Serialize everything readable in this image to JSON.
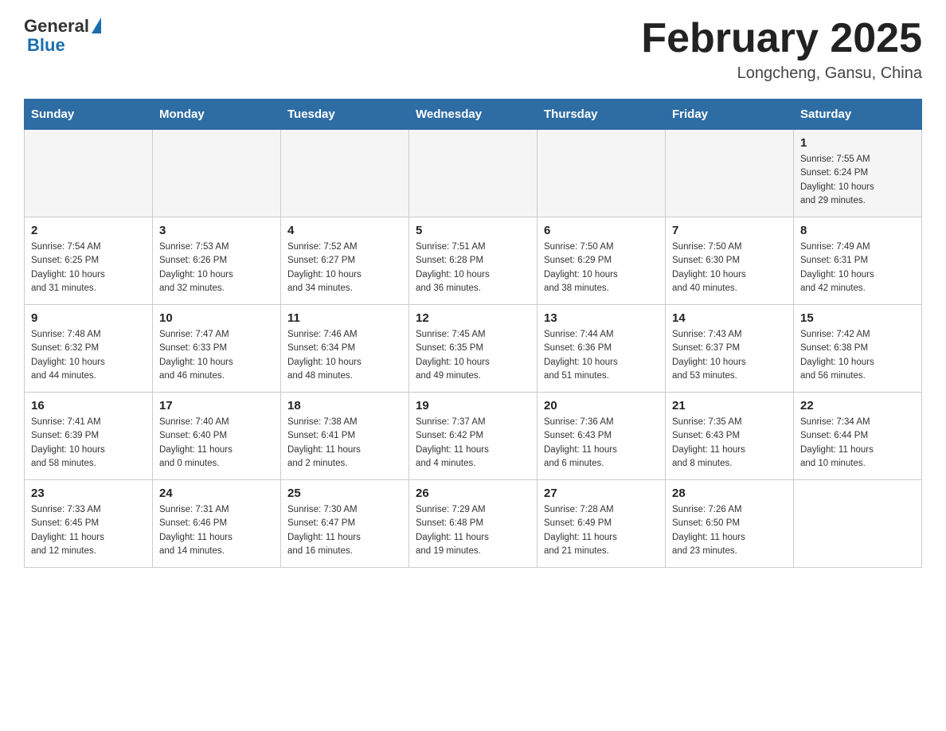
{
  "header": {
    "logo_general": "General",
    "logo_blue": "Blue",
    "month_title": "February 2025",
    "location": "Longcheng, Gansu, China"
  },
  "weekdays": [
    "Sunday",
    "Monday",
    "Tuesday",
    "Wednesday",
    "Thursday",
    "Friday",
    "Saturday"
  ],
  "weeks": [
    [
      {
        "day": "",
        "info": ""
      },
      {
        "day": "",
        "info": ""
      },
      {
        "day": "",
        "info": ""
      },
      {
        "day": "",
        "info": ""
      },
      {
        "day": "",
        "info": ""
      },
      {
        "day": "",
        "info": ""
      },
      {
        "day": "1",
        "info": "Sunrise: 7:55 AM\nSunset: 6:24 PM\nDaylight: 10 hours\nand 29 minutes."
      }
    ],
    [
      {
        "day": "2",
        "info": "Sunrise: 7:54 AM\nSunset: 6:25 PM\nDaylight: 10 hours\nand 31 minutes."
      },
      {
        "day": "3",
        "info": "Sunrise: 7:53 AM\nSunset: 6:26 PM\nDaylight: 10 hours\nand 32 minutes."
      },
      {
        "day": "4",
        "info": "Sunrise: 7:52 AM\nSunset: 6:27 PM\nDaylight: 10 hours\nand 34 minutes."
      },
      {
        "day": "5",
        "info": "Sunrise: 7:51 AM\nSunset: 6:28 PM\nDaylight: 10 hours\nand 36 minutes."
      },
      {
        "day": "6",
        "info": "Sunrise: 7:50 AM\nSunset: 6:29 PM\nDaylight: 10 hours\nand 38 minutes."
      },
      {
        "day": "7",
        "info": "Sunrise: 7:50 AM\nSunset: 6:30 PM\nDaylight: 10 hours\nand 40 minutes."
      },
      {
        "day": "8",
        "info": "Sunrise: 7:49 AM\nSunset: 6:31 PM\nDaylight: 10 hours\nand 42 minutes."
      }
    ],
    [
      {
        "day": "9",
        "info": "Sunrise: 7:48 AM\nSunset: 6:32 PM\nDaylight: 10 hours\nand 44 minutes."
      },
      {
        "day": "10",
        "info": "Sunrise: 7:47 AM\nSunset: 6:33 PM\nDaylight: 10 hours\nand 46 minutes."
      },
      {
        "day": "11",
        "info": "Sunrise: 7:46 AM\nSunset: 6:34 PM\nDaylight: 10 hours\nand 48 minutes."
      },
      {
        "day": "12",
        "info": "Sunrise: 7:45 AM\nSunset: 6:35 PM\nDaylight: 10 hours\nand 49 minutes."
      },
      {
        "day": "13",
        "info": "Sunrise: 7:44 AM\nSunset: 6:36 PM\nDaylight: 10 hours\nand 51 minutes."
      },
      {
        "day": "14",
        "info": "Sunrise: 7:43 AM\nSunset: 6:37 PM\nDaylight: 10 hours\nand 53 minutes."
      },
      {
        "day": "15",
        "info": "Sunrise: 7:42 AM\nSunset: 6:38 PM\nDaylight: 10 hours\nand 56 minutes."
      }
    ],
    [
      {
        "day": "16",
        "info": "Sunrise: 7:41 AM\nSunset: 6:39 PM\nDaylight: 10 hours\nand 58 minutes."
      },
      {
        "day": "17",
        "info": "Sunrise: 7:40 AM\nSunset: 6:40 PM\nDaylight: 11 hours\nand 0 minutes."
      },
      {
        "day": "18",
        "info": "Sunrise: 7:38 AM\nSunset: 6:41 PM\nDaylight: 11 hours\nand 2 minutes."
      },
      {
        "day": "19",
        "info": "Sunrise: 7:37 AM\nSunset: 6:42 PM\nDaylight: 11 hours\nand 4 minutes."
      },
      {
        "day": "20",
        "info": "Sunrise: 7:36 AM\nSunset: 6:43 PM\nDaylight: 11 hours\nand 6 minutes."
      },
      {
        "day": "21",
        "info": "Sunrise: 7:35 AM\nSunset: 6:43 PM\nDaylight: 11 hours\nand 8 minutes."
      },
      {
        "day": "22",
        "info": "Sunrise: 7:34 AM\nSunset: 6:44 PM\nDaylight: 11 hours\nand 10 minutes."
      }
    ],
    [
      {
        "day": "23",
        "info": "Sunrise: 7:33 AM\nSunset: 6:45 PM\nDaylight: 11 hours\nand 12 minutes."
      },
      {
        "day": "24",
        "info": "Sunrise: 7:31 AM\nSunset: 6:46 PM\nDaylight: 11 hours\nand 14 minutes."
      },
      {
        "day": "25",
        "info": "Sunrise: 7:30 AM\nSunset: 6:47 PM\nDaylight: 11 hours\nand 16 minutes."
      },
      {
        "day": "26",
        "info": "Sunrise: 7:29 AM\nSunset: 6:48 PM\nDaylight: 11 hours\nand 19 minutes."
      },
      {
        "day": "27",
        "info": "Sunrise: 7:28 AM\nSunset: 6:49 PM\nDaylight: 11 hours\nand 21 minutes."
      },
      {
        "day": "28",
        "info": "Sunrise: 7:26 AM\nSunset: 6:50 PM\nDaylight: 11 hours\nand 23 minutes."
      },
      {
        "day": "",
        "info": ""
      }
    ]
  ]
}
